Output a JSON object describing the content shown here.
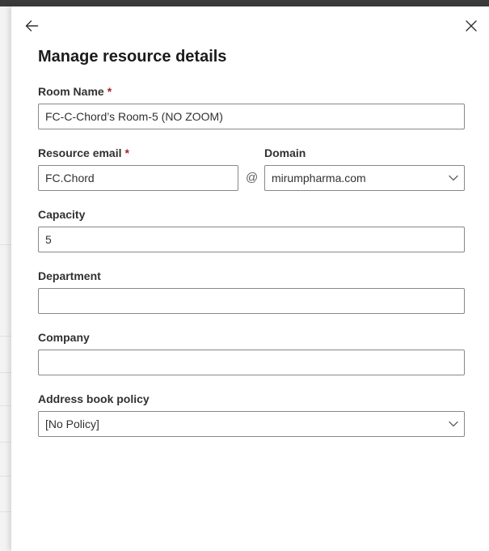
{
  "panel": {
    "title": "Manage resource details",
    "back_icon": "arrow-left-icon",
    "close_icon": "close-icon"
  },
  "form": {
    "room_name": {
      "label": "Room Name",
      "required_mark": "*",
      "value": "FC-C-Chord’s Room-5 (NO ZOOM)"
    },
    "resource_email": {
      "label": "Resource email",
      "required_mark": "*",
      "value": "FC.Chord"
    },
    "at_sign": "@",
    "domain": {
      "label": "Domain",
      "value": "mirumpharma.com"
    },
    "capacity": {
      "label": "Capacity",
      "value": "5"
    },
    "department": {
      "label": "Department",
      "value": ""
    },
    "company": {
      "label": "Company",
      "value": ""
    },
    "address_book_policy": {
      "label": "Address book policy",
      "value": "[No Policy]"
    }
  },
  "colors": {
    "required": "#a4262c",
    "border": "#8a8886",
    "header_bar": "#3b3b3b"
  }
}
